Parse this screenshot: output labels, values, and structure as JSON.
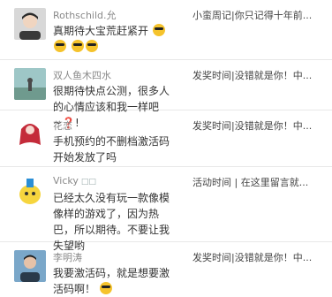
{
  "comments": [
    {
      "user": "Rothschild.允",
      "text": "真期待大宝荒赶紧开",
      "post_title": "小蛮周记|你只记得十年前..."
    },
    {
      "user": "双人鱼木四水",
      "text": "很期待快点公测，很多人的心情应该和我一样吧~",
      "post_title": "发奖时间|没错就是你！中..."
    },
    {
      "user": "花恋",
      "text": "手机预约的不删档激活码开始发放了吗",
      "post_title": "发奖时间|没错就是你！中..."
    },
    {
      "user": "Vicky",
      "text": "已经太久没有玩一款像模像样的游戏了，因为热巴，所以期待。不要让我失望哟",
      "post_title": "活动时间 | 在这里留言就..."
    },
    {
      "user": "李明涛",
      "text": "我要激活码，就是想要激活码啊！",
      "post_title": "发奖时间|没错就是你！中..."
    }
  ],
  "accent": {
    "name_color": "#8a8a8a",
    "divider": "#e8e8e8",
    "heart": "#e8483a",
    "emoji": "#f5c32c"
  }
}
